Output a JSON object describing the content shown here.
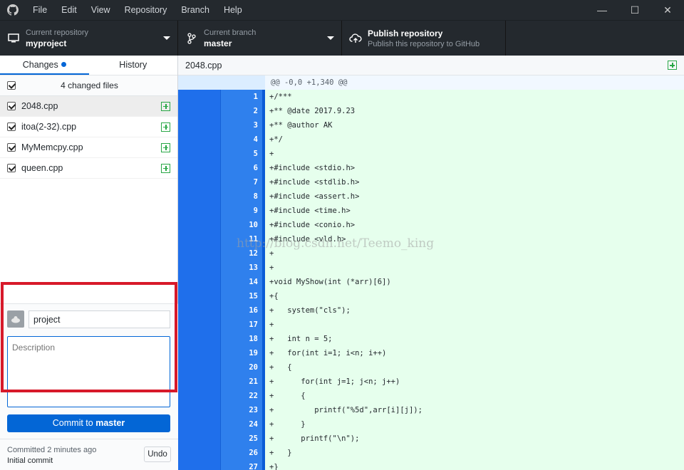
{
  "menu": [
    "File",
    "Edit",
    "View",
    "Repository",
    "Branch",
    "Help"
  ],
  "window_controls": {
    "minimize": "—",
    "maximize": "☐",
    "close": "✕"
  },
  "toolbar": {
    "repo_caption": "Current repository",
    "repo_name": "myproject",
    "branch_caption": "Current branch",
    "branch_name": "master",
    "publish_title": "Publish repository",
    "publish_subtitle": "Publish this repository to GitHub"
  },
  "sidebar": {
    "tabs": {
      "changes": "Changes",
      "history": "History"
    },
    "changed_files_label": "4 changed files",
    "files": [
      {
        "name": "2048.cpp"
      },
      {
        "name": "itoa(2-32).cpp"
      },
      {
        "name": "MyMemcpy.cpp"
      },
      {
        "name": "queen.cpp"
      }
    ]
  },
  "commit": {
    "summary_value": "project",
    "description_placeholder": "Description",
    "button_prefix": "Commit to ",
    "button_branch": "master",
    "last_commit_time": "Committed 2 minutes ago",
    "last_commit_title": "Initial commit",
    "undo_label": "Undo"
  },
  "diff": {
    "file_name": "2048.cpp",
    "hunk_header": "@@ -0,0 +1,340 @@",
    "lines": [
      {
        "n": "1",
        "code": "+/***"
      },
      {
        "n": "2",
        "code": "+** @date 2017.9.23"
      },
      {
        "n": "3",
        "code": "+** @author AK"
      },
      {
        "n": "4",
        "code": "+*/"
      },
      {
        "n": "5",
        "code": "+"
      },
      {
        "n": "6",
        "code": "+#include <stdio.h>"
      },
      {
        "n": "7",
        "code": "+#include <stdlib.h>"
      },
      {
        "n": "8",
        "code": "+#include <assert.h>"
      },
      {
        "n": "9",
        "code": "+#include <time.h>"
      },
      {
        "n": "10",
        "code": "+#include <conio.h>"
      },
      {
        "n": "11",
        "code": "+#include <vld.h>"
      },
      {
        "n": "12",
        "code": "+"
      },
      {
        "n": "13",
        "code": "+"
      },
      {
        "n": "14",
        "code": "+void MyShow(int (*arr)[6])"
      },
      {
        "n": "15",
        "code": "+{"
      },
      {
        "n": "16",
        "code": "+   system(\"cls\");"
      },
      {
        "n": "17",
        "code": "+"
      },
      {
        "n": "18",
        "code": "+   int n = 5;"
      },
      {
        "n": "19",
        "code": "+   for(int i=1; i<n; i++)"
      },
      {
        "n": "20",
        "code": "+   {"
      },
      {
        "n": "21",
        "code": "+      for(int j=1; j<n; j++)"
      },
      {
        "n": "22",
        "code": "+      {"
      },
      {
        "n": "23",
        "code": "+         printf(\"%5d\",arr[i][j]);"
      },
      {
        "n": "24",
        "code": "+      }"
      },
      {
        "n": "25",
        "code": "+      printf(\"\\n\");"
      },
      {
        "n": "26",
        "code": "+   }"
      },
      {
        "n": "27",
        "code": "+}"
      }
    ]
  },
  "watermark": "http://blog.csdn.net/Teemo_king",
  "colors": {
    "accent": "#0366d6",
    "added_bg": "#e6ffed",
    "highlight_box": "#d7192a",
    "titlebar": "#24292e"
  }
}
